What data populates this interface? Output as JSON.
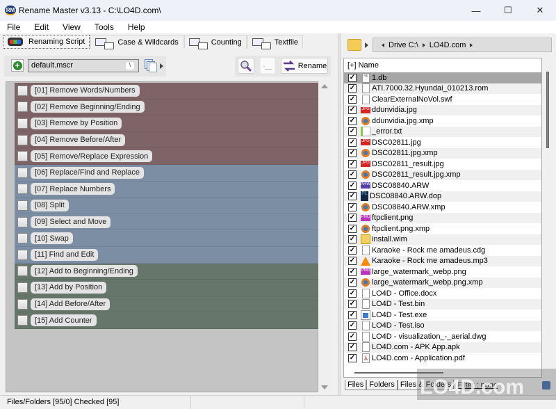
{
  "window": {
    "icon_text": "RM",
    "title": "Rename Master v3.13 - C:\\LO4D.com\\",
    "minimize": "—",
    "maximize": "☐",
    "close": "✕"
  },
  "menu": [
    "File",
    "Edit",
    "View",
    "Tools",
    "Help"
  ],
  "tabs": [
    {
      "label": "Renaming Script",
      "icon": "traffic-light-icon",
      "active": true
    },
    {
      "label": "Case & Wildcards",
      "icon": "ab-case-icon",
      "active": false
    },
    {
      "label": "Counting",
      "icon": "counter-123-icon",
      "active": false
    },
    {
      "label": "Textfile",
      "icon": "ab-textfile-icon",
      "active": false
    }
  ],
  "script_toolbar": {
    "add_icon": "+",
    "script_name": "default.mscr",
    "edit_icon": "\\",
    "rename_label": "Rename",
    "blank_button": "·__"
  },
  "script_steps": [
    {
      "label": "[01]  Remove Words/Numbers",
      "group": "remove",
      "checked": false
    },
    {
      "label": "[02]  Remove Beginning/Ending",
      "group": "remove",
      "checked": false
    },
    {
      "label": "[03]  Remove by Position",
      "group": "remove",
      "checked": false
    },
    {
      "label": "[04]  Remove Before/After",
      "group": "remove",
      "checked": false
    },
    {
      "label": "[05]  Remove/Replace Expression",
      "group": "remove",
      "checked": false
    },
    {
      "label": "[06]  Replace/Find and Replace",
      "group": "replace",
      "checked": false
    },
    {
      "label": "[07]  Replace Numbers",
      "group": "replace",
      "checked": false
    },
    {
      "label": "[08]  Split",
      "group": "replace",
      "checked": false
    },
    {
      "label": "[09]  Select and Move",
      "group": "replace",
      "checked": false
    },
    {
      "label": "[10]  Swap",
      "group": "replace",
      "checked": false
    },
    {
      "label": "[11]  Find and Edit",
      "group": "replace",
      "checked": false
    },
    {
      "label": "[12]  Add to Beginning/Ending",
      "group": "add",
      "checked": false
    },
    {
      "label": "[13]  Add by Position",
      "group": "add",
      "checked": false
    },
    {
      "label": "[14]  Add Before/After",
      "group": "add",
      "checked": false
    },
    {
      "label": "[15]  Add Counter",
      "group": "add",
      "checked": false
    }
  ],
  "group_colors": {
    "remove": "#7e6466",
    "replace": "#7b8ea4",
    "add": "#66766a"
  },
  "browser": {
    "breadcrumb": [
      "Drive C:\\",
      "LO4D.com"
    ],
    "header": "[+] Name",
    "files": [
      {
        "name": "1.db",
        "icon": "db",
        "checked": true,
        "selected": true
      },
      {
        "name": "ATI.7000.32.Hyundai_010213.rom",
        "icon": "doc",
        "checked": true
      },
      {
        "name": "ClearExternalNoVol.swf",
        "icon": "doc",
        "checked": true
      },
      {
        "name": "ddunvidia.jpg",
        "icon": "jpg",
        "checked": true
      },
      {
        "name": "ddunvidia.jpg.xmp",
        "icon": "xmp",
        "checked": true
      },
      {
        "name": "_error.txt",
        "icon": "txt",
        "checked": true
      },
      {
        "name": "DSC02811.jpg",
        "icon": "jpg",
        "checked": true
      },
      {
        "name": "DSC02811.jpg.xmp",
        "icon": "xmp",
        "checked": true
      },
      {
        "name": "DSC02811_result.jpg",
        "icon": "jpg",
        "checked": true
      },
      {
        "name": "DSC02811_result.jpg.xmp",
        "icon": "xmp",
        "checked": true
      },
      {
        "name": "DSC08840.ARW",
        "icon": "arw",
        "checked": true
      },
      {
        "name": "DSC08840.ARW.dop",
        "icon": "dop",
        "checked": true
      },
      {
        "name": "DSC08840.ARW.xmp",
        "icon": "xmp",
        "checked": true
      },
      {
        "name": "ftpclient.png",
        "icon": "png",
        "checked": true
      },
      {
        "name": "ftpclient.png.xmp",
        "icon": "xmp",
        "checked": true
      },
      {
        "name": "install.wim",
        "icon": "wim",
        "checked": true
      },
      {
        "name": "Karaoke - Rock me amadeus.cdg",
        "icon": "doc",
        "checked": true
      },
      {
        "name": "Karaoke - Rock me amadeus.mp3",
        "icon": "mp3",
        "checked": true
      },
      {
        "name": "large_watermark_webp.png",
        "icon": "png",
        "checked": true
      },
      {
        "name": "large_watermark_webp.png.xmp",
        "icon": "xmp",
        "checked": true
      },
      {
        "name": "LO4D - Office.docx",
        "icon": "doc",
        "checked": true
      },
      {
        "name": "LO4D - Test.bin",
        "icon": "doc",
        "checked": true
      },
      {
        "name": "LO4D - Test.exe",
        "icon": "exe",
        "checked": true
      },
      {
        "name": "LO4D - Test.iso",
        "icon": "doc",
        "checked": true
      },
      {
        "name": "LO4D - visualization_-_aerial.dwg",
        "icon": "doc",
        "checked": true
      },
      {
        "name": "LO4D.com - APK App.apk",
        "icon": "doc",
        "checked": true
      },
      {
        "name": "LO4D.com - Application.pdf",
        "icon": "pdf",
        "checked": true
      }
    ],
    "bottom_tabs": [
      "Files",
      "Folders",
      "Files & Folders"
    ],
    "filter": "Filter : none"
  },
  "status": {
    "counts": "Files/Folders [95/0] Checked [95]",
    "cell2": "",
    "cell3": ""
  },
  "watermark": "LO4D.com"
}
